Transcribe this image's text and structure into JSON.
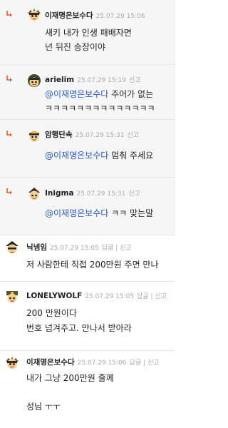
{
  "comments": [
    {
      "nick": "이재명은보수다",
      "date": "25.07.29 15:06",
      "action": "",
      "lines": [
        {
          "text": "새키 내가 인생 패배자면"
        },
        {
          "text": "넌 뒤진 송장이야"
        }
      ]
    },
    {
      "nick": "arielim",
      "date": "25.07.29 15:19",
      "action": "신고",
      "lines": [
        {
          "mention": "@이재명은보수다",
          "text": " 주어가 없는"
        },
        {
          "text": "ㅋㅋㅋㅋㅋㅋㅋㅋㅋㅋㅋㅋㅋㅋ"
        }
      ]
    },
    {
      "nick": "암행단속",
      "date": "25.07.29 15:31",
      "action": "신고",
      "lines": [
        {
          "mention": "@이재명은보수다",
          "text": " 멈춰 주세요"
        }
      ]
    },
    {
      "nick": "Inigma",
      "date": "25.07.29 15:31",
      "action": "신고",
      "lines": [
        {
          "mention": "@이재명은보수다",
          "text": " ㅋㅋ 맞는말"
        }
      ]
    },
    {
      "nick": "닉넴임",
      "date": "25.07.29 15:05",
      "action": "답글 | 신고",
      "lines": [
        {
          "text": "저 사람한테 직접 200만원 주면 만나"
        }
      ]
    },
    {
      "nick": "LONELYWOLF",
      "date": "25.07.29 15:05",
      "action": "답글 | 신고",
      "lines": [
        {
          "text": "200 만원이다"
        },
        {
          "text": "번호 넘겨주고. 만나서 받아라"
        }
      ]
    },
    {
      "nick": "이재명은보수다",
      "date": "25.07.29 15:06",
      "action": "답글 | 신고",
      "lines": [
        {
          "text": "내가 그냥 200만원 줄께"
        },
        {
          "text": ""
        },
        {
          "text": "성님 ㅜㅜ"
        }
      ]
    }
  ]
}
